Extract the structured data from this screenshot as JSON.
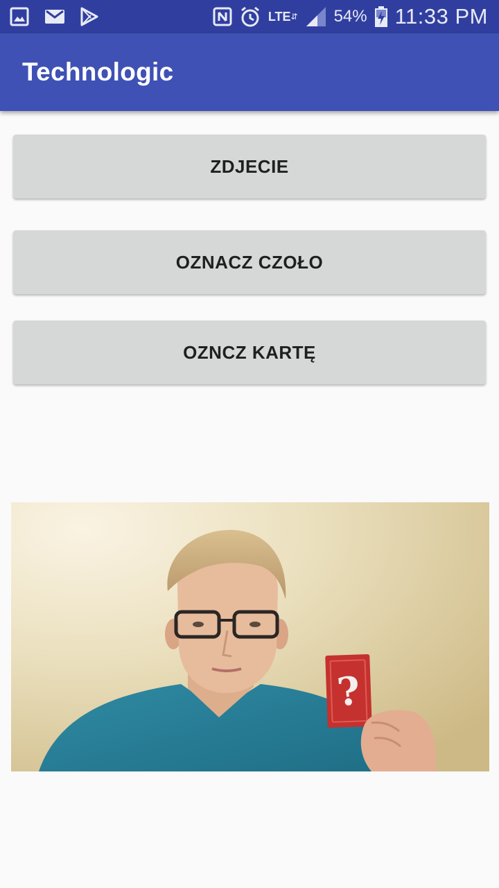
{
  "status_bar": {
    "notification_icons": [
      "image-icon",
      "gmail-icon",
      "play-store-icon"
    ],
    "system_icons": [
      "nfc-icon",
      "alarm-icon",
      "lte-icon",
      "signal-icon",
      "battery-charging-icon"
    ],
    "network": "LTE",
    "battery": "54%",
    "time": "11:33 PM"
  },
  "app_bar": {
    "title": "Technologic",
    "color": "#3f51b5"
  },
  "buttons": {
    "photo_label": "ZDJECIE",
    "mark_forehead_label": "OZNACZ CZOŁO",
    "mark_card_label": "OZNCZ KARTĘ"
  },
  "image": {
    "card_symbol": "?"
  },
  "colors": {
    "status_bar": "#303f9f",
    "button": "#d6d7d7",
    "background": "#fafafa"
  }
}
